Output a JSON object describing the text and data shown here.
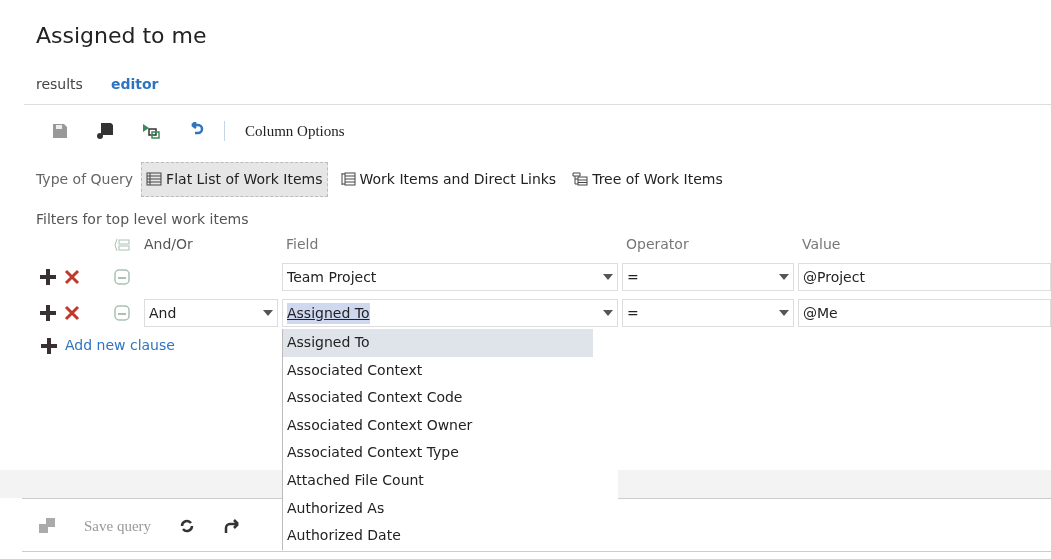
{
  "title": "Assigned to me",
  "tabs": [
    {
      "label": "results",
      "selected": false
    },
    {
      "label": "editor",
      "selected": true
    }
  ],
  "toolbar": {
    "column_options": "Column Options"
  },
  "query_type": {
    "label": "Type of Query",
    "options": [
      {
        "label": "Flat List of Work Items",
        "kind": "flat",
        "selected": true
      },
      {
        "label": "Work Items and Direct Links",
        "kind": "links",
        "selected": false
      },
      {
        "label": "Tree of Work Items",
        "kind": "tree",
        "selected": false
      }
    ]
  },
  "filters": {
    "label": "Filters for top level work items",
    "columns": [
      "And/Or",
      "Field",
      "Operator",
      "Value"
    ],
    "rows": [
      {
        "and_or": null,
        "field": "Team Project",
        "operator": "=",
        "value": "@Project",
        "focused": false
      },
      {
        "and_or": "And",
        "field": "Assigned To",
        "operator": "=",
        "value": "@Me",
        "focused": true
      }
    ],
    "add_clause": "Add new clause"
  },
  "field_dropdown": {
    "items": [
      {
        "label": "Assigned To",
        "selected": true
      },
      {
        "label": "Associated Context",
        "selected": false
      },
      {
        "label": "Associated Context Code",
        "selected": false
      },
      {
        "label": "Associated Context Owner",
        "selected": false
      },
      {
        "label": "Associated Context Type",
        "selected": false
      },
      {
        "label": "Attached File Count",
        "selected": false
      },
      {
        "label": "Authorized As",
        "selected": false
      },
      {
        "label": "Authorized Date",
        "selected": false
      }
    ]
  },
  "bottom_toolbar": {
    "save": "Save query"
  }
}
